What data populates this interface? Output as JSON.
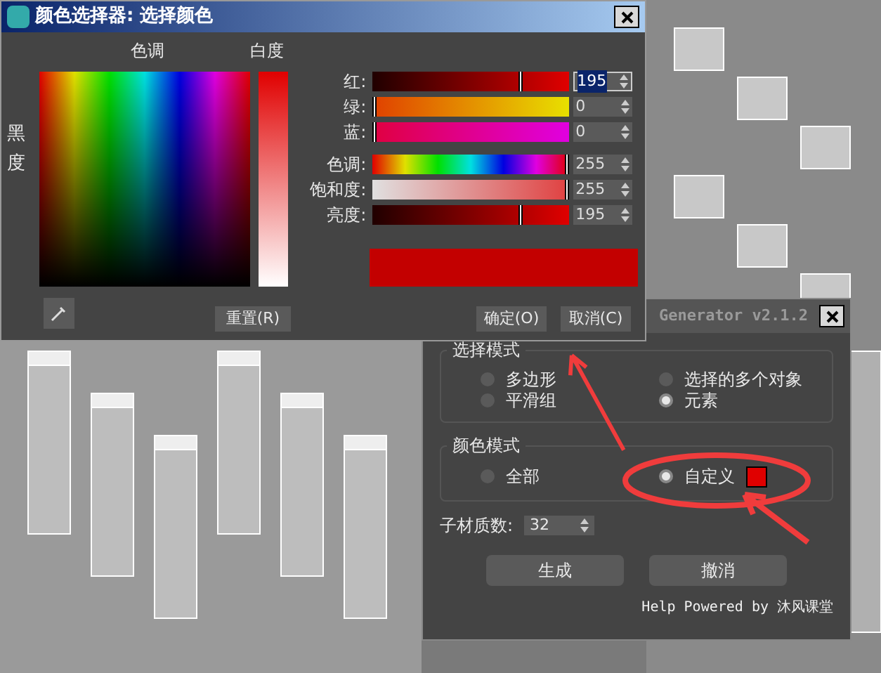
{
  "color_picker": {
    "title": "颜色选择器: 选择颜色",
    "hue_label": "色调",
    "whiteness_label": "白度",
    "blackness_label": "黑度",
    "sliders": [
      {
        "kind": "red",
        "label": "红:",
        "value": "195",
        "level": 0.765,
        "focused": true
      },
      {
        "kind": "green",
        "label": "绿:",
        "value": "0",
        "level": 0,
        "focused": false
      },
      {
        "kind": "blue",
        "label": "蓝:",
        "value": "0",
        "level": 0,
        "focused": false
      },
      {
        "kind": "hue",
        "label": "色调:",
        "value": "255",
        "level": 1,
        "focused": false
      },
      {
        "kind": "saturation",
        "label": "饱和度:",
        "value": "255",
        "level": 1,
        "focused": false
      },
      {
        "kind": "brightness",
        "label": "亮度:",
        "value": "195",
        "level": 0.765,
        "focused": false
      }
    ],
    "buttons": [
      {
        "label": "重置(R)"
      },
      {
        "label": "确定(O)"
      },
      {
        "label": "取消(C)"
      }
    ]
  },
  "generator": {
    "title": "Generator v2.1.2",
    "selection_mode": {
      "label": "选择模式",
      "options": [
        {
          "label": "多边形",
          "selected": false
        },
        {
          "label": "选择的多个对象",
          "selected": false
        },
        {
          "label": "平滑组",
          "selected": false
        },
        {
          "label": "元素",
          "selected": true
        }
      ]
    },
    "color_mode": {
      "label": "颜色模式",
      "options": [
        {
          "label": "全部",
          "selected": false
        },
        {
          "label": "自定义",
          "selected": true,
          "color": "#e00000"
        }
      ]
    },
    "sub_material": {
      "label": "子材质数:",
      "value": "32"
    },
    "buttons": [
      {
        "label": "生成"
      },
      {
        "label": "撤消"
      }
    ],
    "footer": "Help Powered by 沐风课堂"
  }
}
